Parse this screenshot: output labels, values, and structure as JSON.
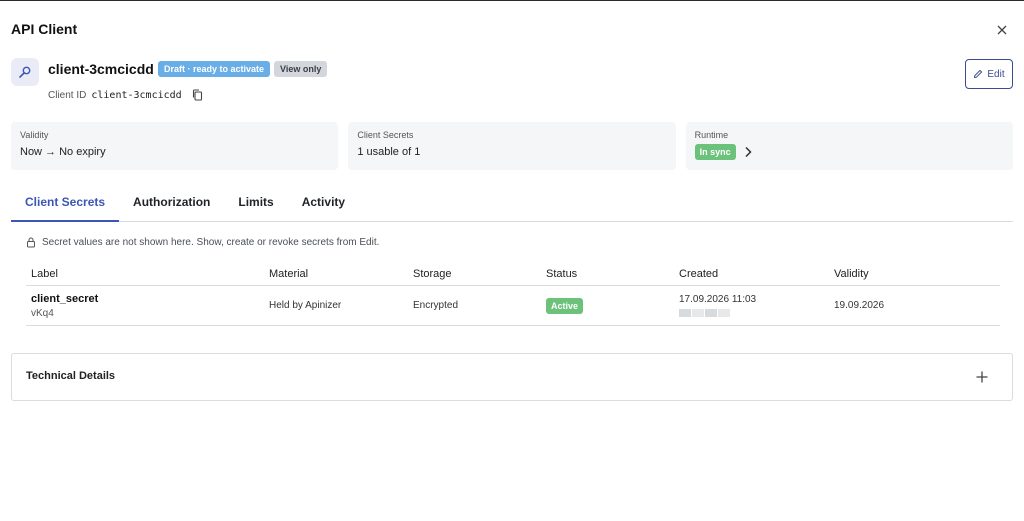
{
  "window": {
    "title": "API Client"
  },
  "client": {
    "name": "client-3cmcicdd",
    "status_badge": "Draft · ready to activate",
    "view_badge": "View only",
    "id_label": "Client ID",
    "id_value": "client-3cmcicdd",
    "edit_label": "Edit"
  },
  "cards": {
    "validity": {
      "label": "Validity",
      "value": "Now → No expiry"
    },
    "secrets": {
      "label": "Client Secrets",
      "value": "1 usable of 1"
    },
    "runtime": {
      "label": "Runtime",
      "badge": "In sync"
    }
  },
  "tabs": [
    {
      "label": "Client Secrets",
      "active": true
    },
    {
      "label": "Authorization",
      "active": false
    },
    {
      "label": "Limits",
      "active": false
    },
    {
      "label": "Activity",
      "active": false
    }
  ],
  "info_text": "Secret values are not shown here. Show, create or revoke secrets from Edit.",
  "table": {
    "headers": [
      "Label",
      "Material",
      "Storage",
      "Status",
      "Created",
      "Validity"
    ],
    "rows": [
      {
        "label": "client_secret",
        "sublabel": "vKq4",
        "material": "Held by Apinizer",
        "storage": "Encrypted",
        "status": "Active",
        "created": "17.09.2026 11:03",
        "validity": "19.09.2026"
      }
    ]
  },
  "technical": {
    "title": "Technical Details"
  },
  "icons": {
    "close": "close-icon",
    "client": "key-search-icon",
    "copy": "copy-icon",
    "edit": "pencil-icon",
    "chevron": "chevron-right-icon",
    "lock": "lock-icon",
    "plus": "plus-icon"
  },
  "colors": {
    "accent": "#3b56b6",
    "draft_badge": "#69aee6",
    "success_badge": "#6cc27a",
    "view_badge": "#d3d6dc"
  }
}
